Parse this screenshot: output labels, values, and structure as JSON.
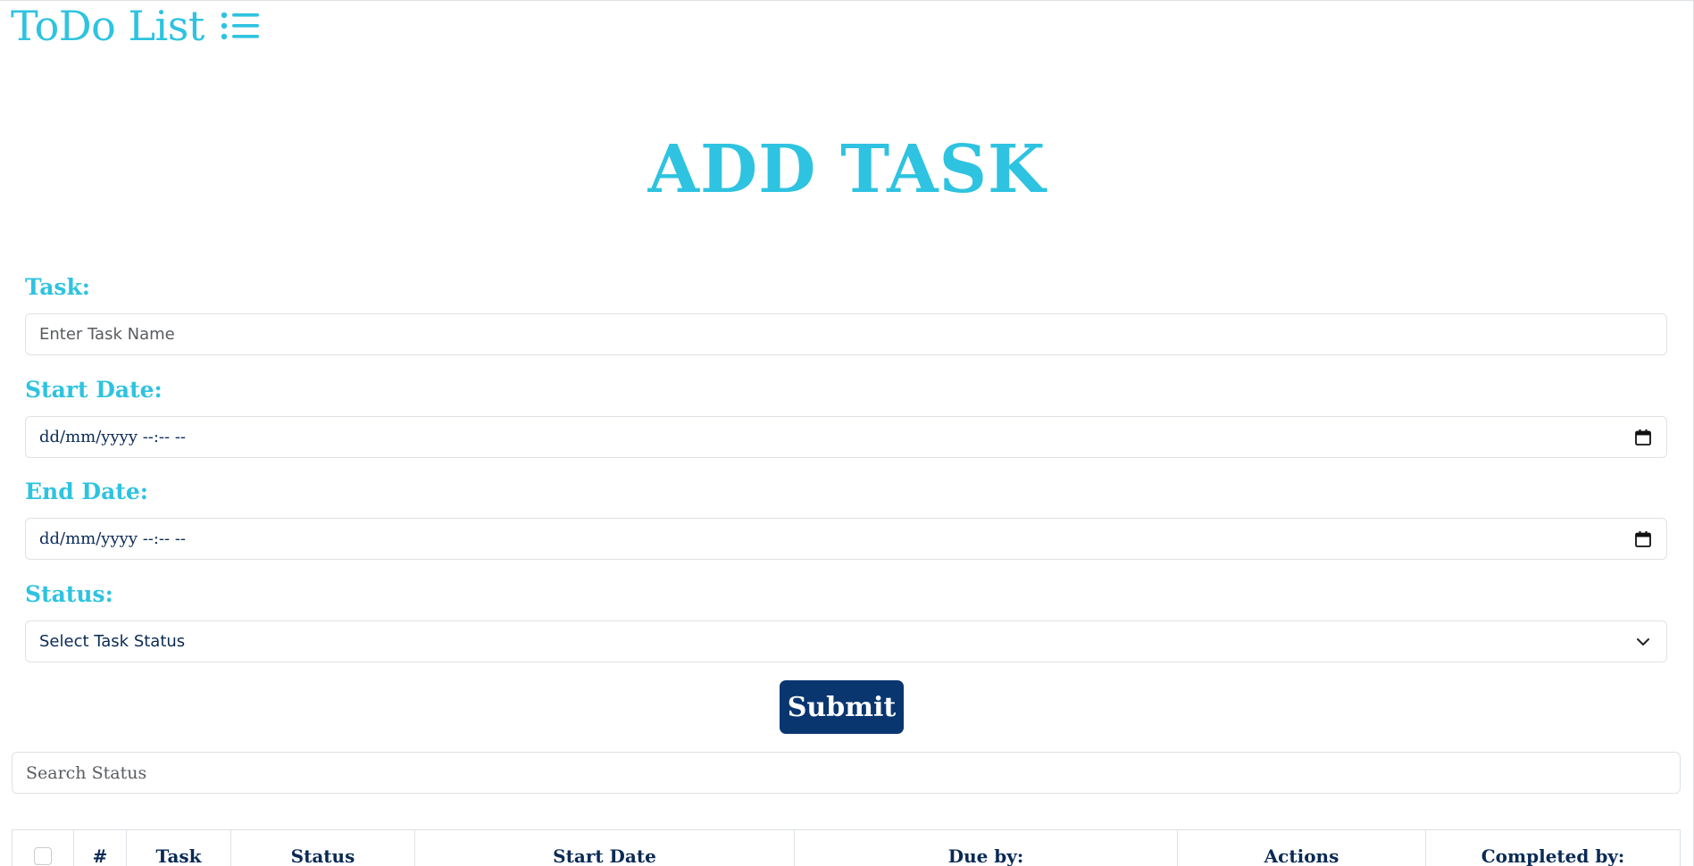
{
  "brand": {
    "title": "ToDo List",
    "icon": "list-icon",
    "color": "#2ec3e0"
  },
  "heading": "ADD TASK",
  "form": {
    "task": {
      "label": "Task:",
      "placeholder": "Enter Task Name"
    },
    "start_date": {
      "label": "Start Date:",
      "value": "dd/mm/yyyy --:-- --",
      "icon": "calendar-icon"
    },
    "end_date": {
      "label": "End Date:",
      "value": "dd/mm/yyyy --:-- --",
      "icon": "calendar-icon"
    },
    "status": {
      "label": "Status:",
      "selected": "Select Task Status",
      "icon": "chevron-down-icon"
    },
    "submit_label": "Submit"
  },
  "search": {
    "placeholder": "Search Status"
  },
  "table": {
    "columns": [
      "#",
      "Task",
      "Status",
      "Start Date",
      "Due by:",
      "Actions",
      "Completed by:"
    ]
  },
  "colors": {
    "accent": "#2ec3e0",
    "primary": "#0a3670",
    "text_dark": "#0a2a55",
    "border": "#dee2e6"
  }
}
